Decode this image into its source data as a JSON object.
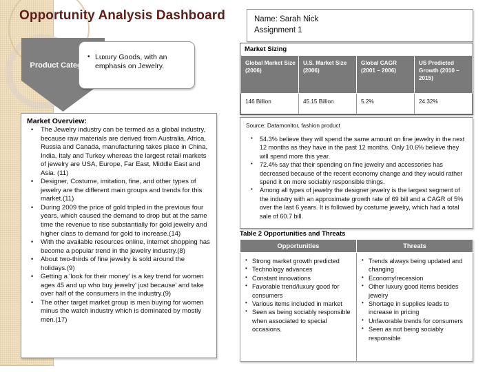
{
  "colors": {
    "title": "#5c1f1a",
    "header_gray": "#7a7a7a",
    "panel_beige": "#f2e2c4",
    "chevron_gray": "#7f7f7f"
  },
  "title": "Opportunity Analysis Dashboard",
  "product_category": {
    "label": "Product Category:",
    "bullets": [
      "Luxury Goods, with an emphasis on Jewelry."
    ]
  },
  "market_overview": {
    "heading": "Market Overview:",
    "bullets": [
      "The Jewelry industry can be termed as a global industry, because raw materials are derived from Australia, Africa, Russia and Canada, manufacturing takes place in China, India, Italy and Turkey whereas the largest retail markets of jewelry are USA, Europe, Far East, Middle East and Asia. (11)",
      "Designer, Costume, imitation, fine, and other types of jewelry are the different main groups and trends for this market.(11)",
      "During 2009 the price of gold tripled in the previous four years, which caused the demand to drop but at the same time the revenue to rise substantially for gold jewelry and higher class to demand for gold to increase.(14)",
      "With the available resources online, internet shopping has become a popular trend in the jewelry industry.(8)",
      "About two-thirds of fine jewelry is sold around the holidays.(9)",
      "Getting a 'look for their money' is a key trend for women ages 45 and up who buy jewelry' just because' and take over half of the consumers in the industry.(9)",
      "The other target market group is men buying for women minus the watch industry which is dominated by mostly men.(17)"
    ]
  },
  "name_box": {
    "name_line": "Name: Sarah Nick",
    "assignment_line": "Assignment 1"
  },
  "market_sizing": {
    "caption": "Market Sizing",
    "headers": [
      "Global Market Size (2006)",
      "U.S. Market Size (2006)",
      "Global CAGR (2001 – 2006)",
      "US Predicted Growth (2010 – 2015)"
    ],
    "row": [
      "146 Billion",
      "45.15 Billion",
      "5.2%",
      "24.32%"
    ]
  },
  "insights": {
    "source": "Source: Datamonitor, fashion product",
    "bullets": [
      "54.3% believe they will spend the same amount on fine jewelry in the next 12 months as they have in the past 12 months. Only 10.6% believe they will spend more this year.",
      "72.4% say that their spending on fine jewelry and accessories has decreased because of the recent economy change and they would rather spend it on more sociably responsible things.",
      "Among all types of jewelry the designer jewelry is the largest segment of the industry with an approximate growth rate of 69 bill and a CAGR of 5% over the last 6 years. It is followed by costume jewelry, which had a total sale of 60.7 bill."
    ]
  },
  "swot": {
    "caption": "Table 2 Opportunities and Threats",
    "headers": [
      "Opportunities",
      "Threats"
    ],
    "opportunities": [
      "Strong market growth predicted",
      "Technology advances",
      "Constant innovations",
      "Favorable trend/luxury good for consumers",
      "Various items included in market",
      "Seen as being sociably responsible when associated to special occasions."
    ],
    "threats": [
      "Trends always being updated and changing",
      "Economy/recession",
      "Other luxury good items besides jewelry",
      "Shortage in supplies leads to increase in pricing",
      "Unfavorable trends for consumers",
      "Seen as not being sociably responsible"
    ]
  }
}
